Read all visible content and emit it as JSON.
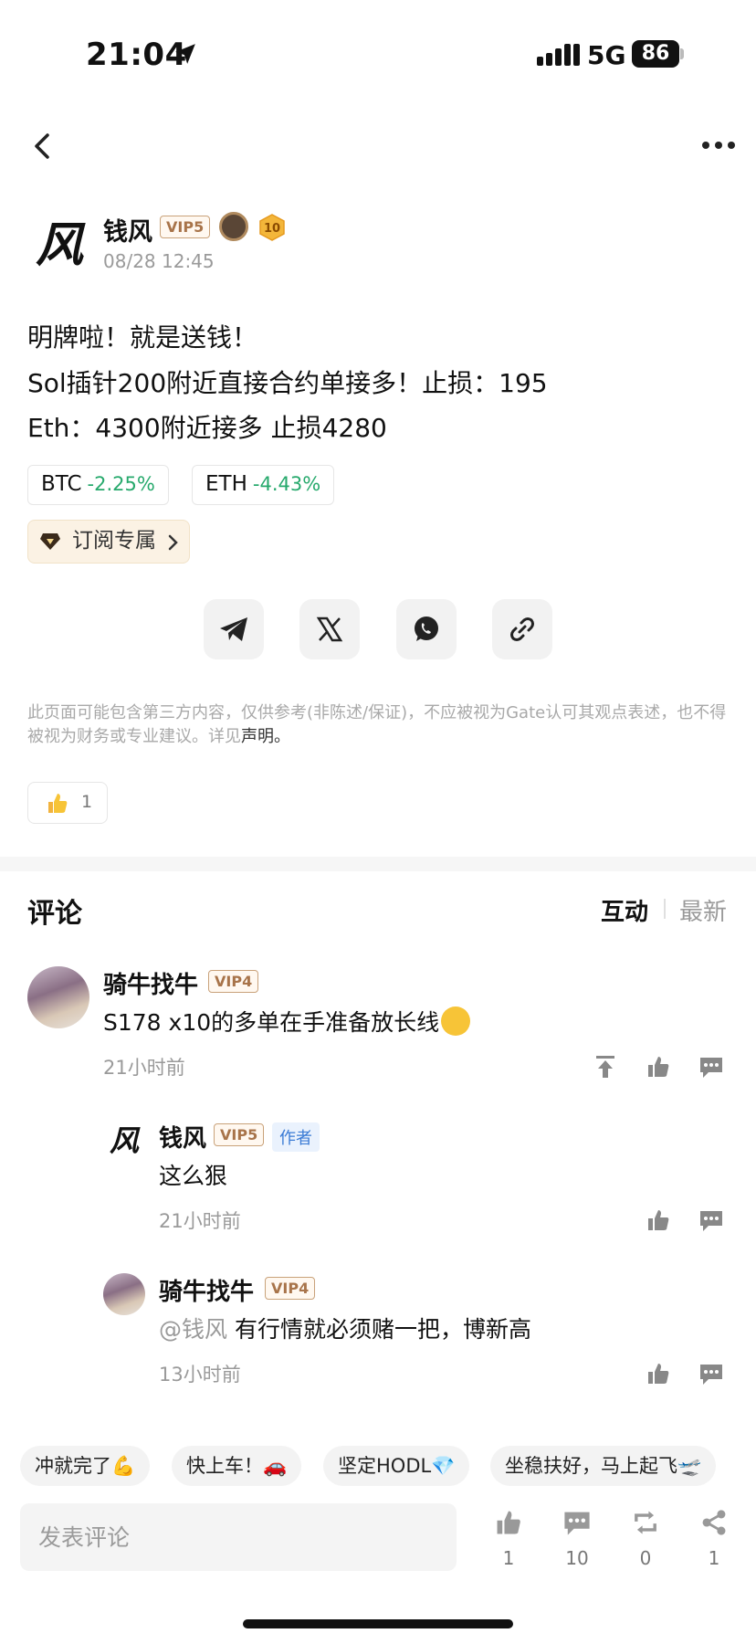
{
  "status_bar": {
    "time": "21:04",
    "network": "5G",
    "battery": "86"
  },
  "post": {
    "author": {
      "name": "钱风",
      "vip": "VIP5",
      "level_badge": "10",
      "avatar_glyph": "风"
    },
    "time": "08/28 12:45",
    "lines": [
      "明牌啦！就是送钱！",
      "Sol插针200附近直接合约单接多！止损：195",
      "Eth：4300附近接多 止损4280"
    ],
    "tickers": [
      {
        "symbol": "BTC",
        "change": "-2.25%"
      },
      {
        "symbol": "ETH",
        "change": "-4.43%"
      }
    ],
    "subscribe_label": "订阅专属",
    "disclaimer": "此页面可能包含第三方内容，仅供参考(非陈述/保证)，不应被视为Gate认可其观点表述，也不得被视为财务或专业建议。详见",
    "disclaimer_link": "声明。",
    "like_count": "1"
  },
  "comments_section": {
    "title": "评论",
    "sort_options": [
      "互动",
      "最新"
    ],
    "comments": [
      {
        "name": "骑牛找牛",
        "vip": "VIP4",
        "text": "S178 x10的多单在手准备放长线",
        "time": "21小时前"
      },
      {
        "name": "钱风",
        "vip": "VIP5",
        "author_tag": "作者",
        "text": "这么狠",
        "time": "21小时前",
        "avatar_glyph": "风"
      },
      {
        "name": "骑牛找牛",
        "vip": "VIP4",
        "mention": "@钱风",
        "text": "有行情就必须赌一把，博新高",
        "time": "13小时前"
      }
    ]
  },
  "quick_replies": [
    "冲就完了💪",
    "快上车！🚗",
    "坚定HODL💎",
    "坐稳扶好，马上起飞🛫"
  ],
  "bottom_bar": {
    "input_placeholder": "发表评论",
    "likes": "1",
    "comments": "10",
    "reposts": "0",
    "shares": "1"
  },
  "colors": {
    "positive_change": "#26a96c",
    "vip_border": "#c9a27a",
    "author_tag": "#3a7bd5",
    "subscribe_bg": "#fbf2e4"
  }
}
